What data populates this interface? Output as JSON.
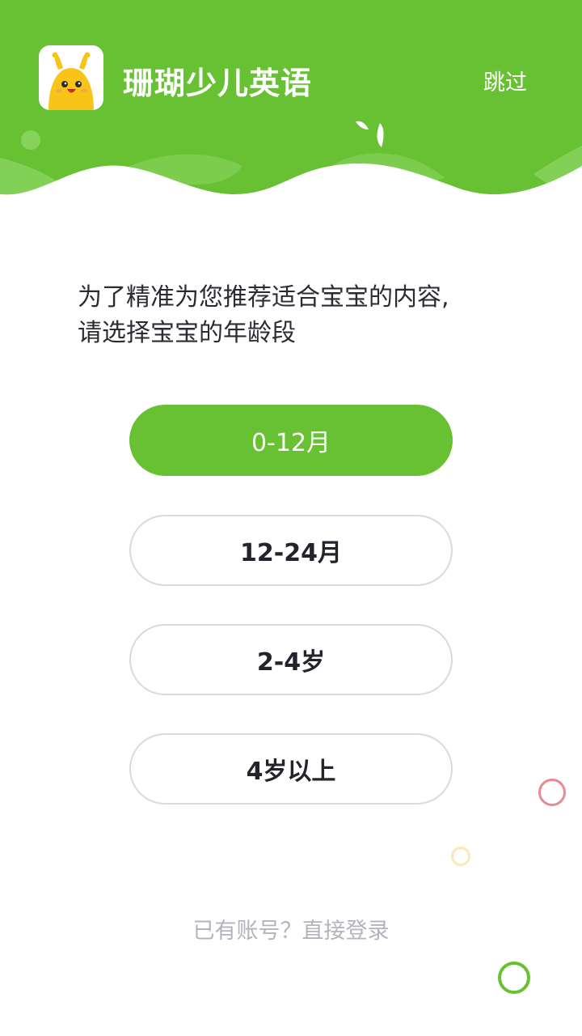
{
  "header": {
    "app_name": "珊瑚少儿英语",
    "skip_label": "跳过",
    "colors": {
      "primary": "#67c132",
      "wave_light": "#86d25a"
    }
  },
  "prompt": {
    "line1": "为了精准为您推荐适合宝宝的内容,",
    "line2": "请选择宝宝的年龄段"
  },
  "age_options": [
    {
      "label": "0-12月",
      "selected": true
    },
    {
      "label": "12-24月",
      "selected": false
    },
    {
      "label": "2-4岁",
      "selected": false
    },
    {
      "label": "4岁以上",
      "selected": false
    }
  ],
  "login_link": "已有账号？直接登录",
  "decorations": {
    "ring_colors": [
      "#e88a8f",
      "#fde6b8",
      "#67c132"
    ]
  }
}
